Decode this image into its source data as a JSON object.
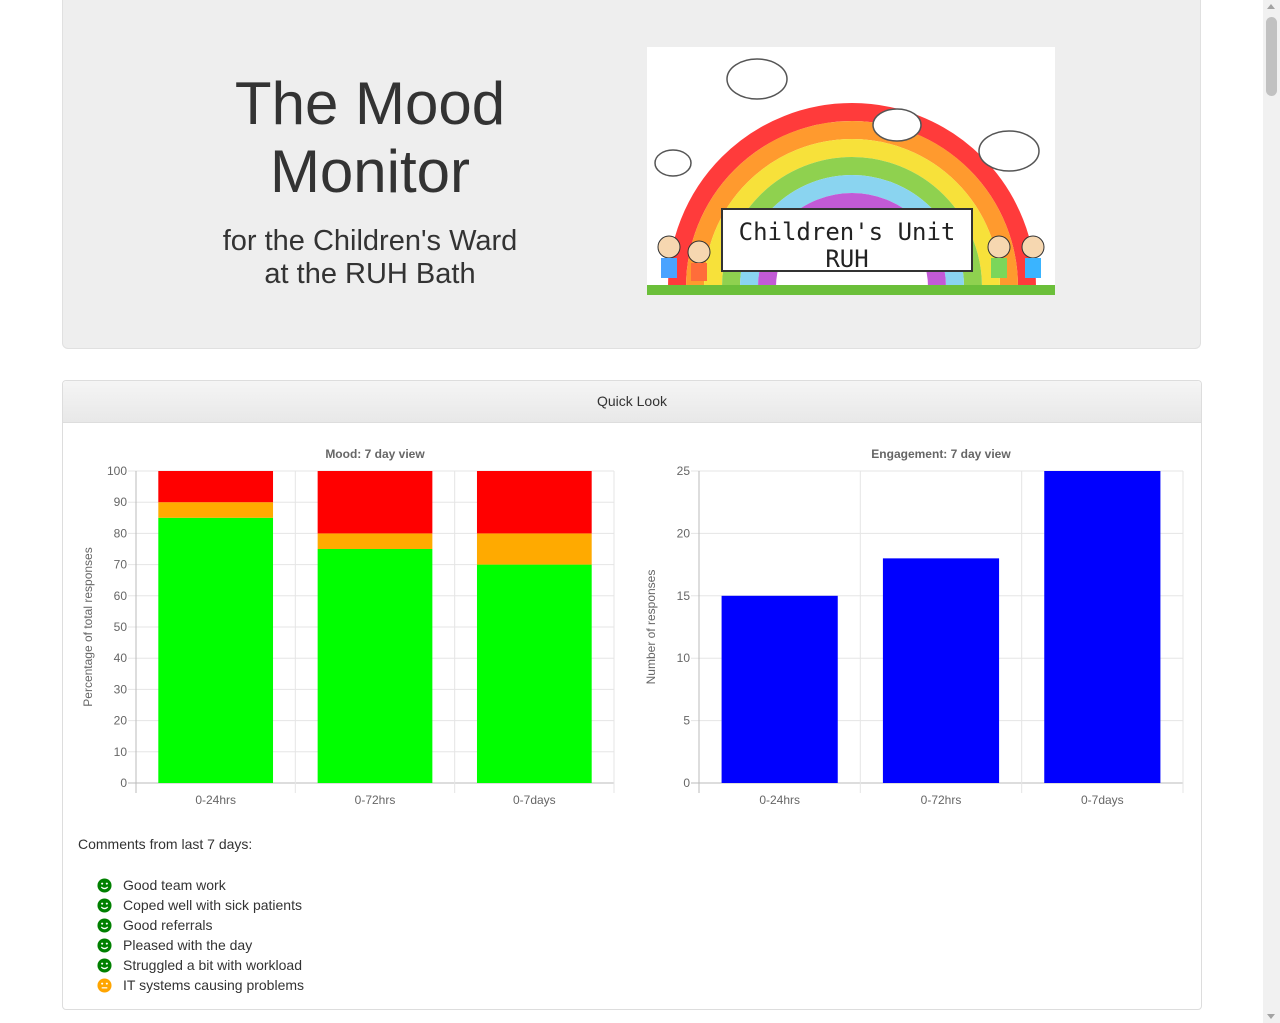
{
  "header": {
    "title": "The Mood Monitor",
    "subtitle_line1": "for the Children's Ward",
    "subtitle_line2": "at the RUH Bath",
    "logo_text_line1": "Children's Unit",
    "logo_text_line2": "RUH"
  },
  "panel": {
    "heading": "Quick Look",
    "comments_title": "Comments from last 7 days:",
    "comments": [
      {
        "text": "Good team work",
        "mood": "happy",
        "color": "#008000"
      },
      {
        "text": "Coped well with sick patients",
        "mood": "happy",
        "color": "#008000"
      },
      {
        "text": "Good referrals",
        "mood": "happy",
        "color": "#008000"
      },
      {
        "text": "Pleased with the day",
        "mood": "happy",
        "color": "#008000"
      },
      {
        "text": "Struggled a bit with workload",
        "mood": "happy",
        "color": "#008000"
      },
      {
        "text": "IT systems causing problems",
        "mood": "neutral",
        "color": "#ffa500"
      }
    ]
  },
  "chart_data": [
    {
      "type": "bar",
      "stacked": true,
      "title": "Mood: 7 day view",
      "xlabel": "",
      "ylabel": "Percentage of total responses",
      "categories": [
        "0-24hrs",
        "0-72hrs",
        "0-7days"
      ],
      "ylim": [
        0,
        100
      ],
      "yticks": [
        0,
        10,
        20,
        30,
        40,
        50,
        60,
        70,
        80,
        90,
        100
      ],
      "series": [
        {
          "values": [
            85,
            75,
            70
          ],
          "color": "#00ff00"
        },
        {
          "values": [
            5,
            5,
            10
          ],
          "color": "#ffaa00"
        },
        {
          "values": [
            10,
            20,
            20
          ],
          "color": "#ff0000"
        }
      ],
      "grid": true
    },
    {
      "type": "bar",
      "title": "Engagement: 7 day view",
      "xlabel": "",
      "ylabel": "Number of responses",
      "categories": [
        "0-24hrs",
        "0-72hrs",
        "0-7days"
      ],
      "ylim": [
        0,
        25
      ],
      "yticks": [
        0,
        5,
        10,
        15,
        20,
        25
      ],
      "series": [
        {
          "values": [
            15,
            18,
            25
          ],
          "color": "#0000ff"
        }
      ],
      "grid": true
    }
  ]
}
